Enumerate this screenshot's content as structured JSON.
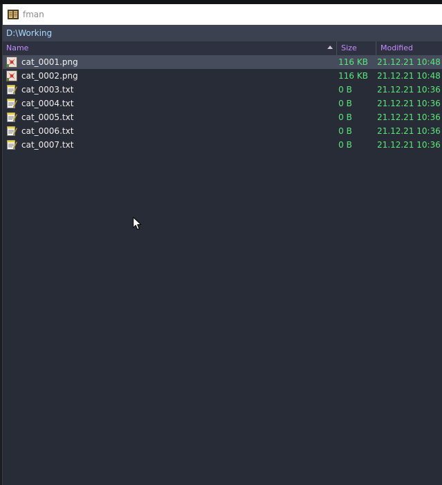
{
  "window": {
    "title": "fman"
  },
  "path": "D:\\Working",
  "columns": {
    "name": "Name",
    "size": "Size",
    "modified": "Modified",
    "sort_column": "Name",
    "sort_direction": "ascending"
  },
  "files": [
    {
      "name": "cat_0001.png",
      "size": "116 KB",
      "modified": "21.12.21 10:48",
      "type": "image",
      "selected": true
    },
    {
      "name": "cat_0002.png",
      "size": "116 KB",
      "modified": "21.12.21 10:48",
      "type": "image",
      "selected": false
    },
    {
      "name": "cat_0003.txt",
      "size": "0 B",
      "modified": "21.12.21 10:36",
      "type": "text",
      "selected": false
    },
    {
      "name": "cat_0004.txt",
      "size": "0 B",
      "modified": "21.12.21 10:36",
      "type": "text",
      "selected": false
    },
    {
      "name": "cat_0005.txt",
      "size": "0 B",
      "modified": "21.12.21 10:36",
      "type": "text",
      "selected": false
    },
    {
      "name": "cat_0006.txt",
      "size": "0 B",
      "modified": "21.12.21 10:36",
      "type": "text",
      "selected": false
    },
    {
      "name": "cat_0007.txt",
      "size": "0 B",
      "modified": "21.12.21 10:36",
      "type": "text",
      "selected": false
    }
  ],
  "icons": {
    "app": "fman-app-icon",
    "image_file": "image-file-icon",
    "text_file": "text-file-icon",
    "sort": "sort-ascending-icon",
    "cursor": "mouse-cursor"
  },
  "colors": {
    "background": "#282c37",
    "path_bar": "#3b4150",
    "path_text": "#a8dbff",
    "header_text": "#c58cff",
    "file_name": "#f0f0f0",
    "file_meta": "#5be87a",
    "selection": "#464c5c"
  }
}
